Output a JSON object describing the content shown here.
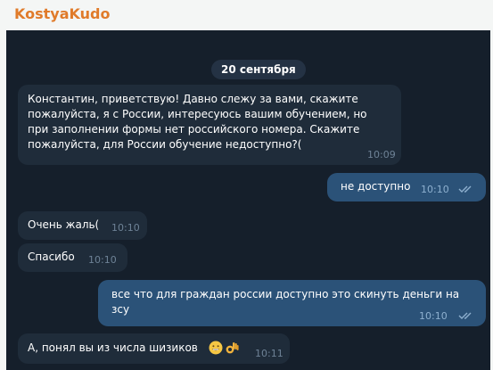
{
  "header": {
    "title": "KostyaKudo"
  },
  "chat": {
    "date": "20 сентября",
    "messages": [
      {
        "text": "Константин, приветствую! Давно слежу за вами, скажите\nпожалуйста, я с России, интересуюсь вашим обучением, но\nпри заполнении формы нет российского номера. Скажите\nпожалуйста, для России обучение недоступно?(",
        "time": "10:09"
      },
      {
        "text": "не доступно",
        "time": "10:10"
      },
      {
        "text": "Очень жаль(",
        "time": "10:10"
      },
      {
        "text": "Спасибо",
        "time": "10:10"
      },
      {
        "text": "все что для граждан россии доступно это скинуть деньги на\nзсу",
        "time": "10:10"
      },
      {
        "text": "А, понял вы из числа шизиков",
        "time": "10:11",
        "emojis": [
          "grinning-face-icon",
          "ok-hand-icon"
        ]
      }
    ]
  },
  "colors": {
    "title": "#e07b2a",
    "chat_bg": "#151f2b",
    "incoming": "#1f2c3a",
    "outgoing": "#2b5278"
  }
}
